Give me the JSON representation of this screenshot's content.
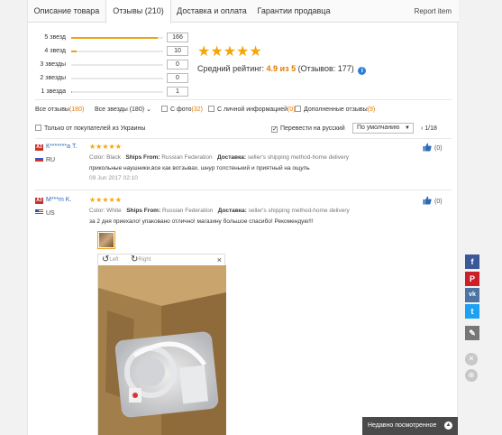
{
  "tabs": [
    {
      "label": "Описание товара"
    },
    {
      "label": "Отзывы (210)"
    },
    {
      "label": "Доставка и оплата"
    },
    {
      "label": "Гарантии продавца"
    }
  ],
  "report_label": "Report item",
  "rating_breakdown": [
    {
      "label": "5 звезд",
      "count": "166",
      "fraction": 0.94
    },
    {
      "label": "4 звезд",
      "count": "10",
      "fraction": 0.06
    },
    {
      "label": "3 звезды",
      "count": "0",
      "fraction": 0
    },
    {
      "label": "2 звезды",
      "count": "0",
      "fraction": 0
    },
    {
      "label": "1 звезда",
      "count": "1",
      "fraction": 0.01
    }
  ],
  "summary": {
    "stars": "★★★★★",
    "avg_label": "Средний рейтинг:",
    "avg_value": "4.9 из 5",
    "reviews_count": "(Отзывов: 177)",
    "info": "i"
  },
  "filters": {
    "all": {
      "label": "Все отзывы",
      "count": "(180)"
    },
    "all_stars": {
      "label": "Все звезды (180)"
    },
    "photo": {
      "label": "С фото",
      "count": "(32)"
    },
    "personal": {
      "label": "С личной информацией",
      "count": "(0)"
    },
    "extra": {
      "label": "Дополненные отзывы",
      "count": "(9)"
    }
  },
  "options": {
    "ukraine_only": "Только от покупателей из Украины",
    "translate": "Перевести на русский",
    "sort_value": "По умолчанию",
    "pager": "1/18"
  },
  "reviews": [
    {
      "badge": "A3",
      "name": "К*******а Т.",
      "country": "RU",
      "stars": "★★★★★",
      "meta_color_label": "Color:",
      "meta_color": "Black",
      "meta_ships_label": "Ships From:",
      "meta_ships": "Russian Federation",
      "meta_delivery_label": "Доставка:",
      "meta_delivery": "seller's shipping method-home delivery",
      "text": "прикольные наушники,все как вотзывах. шнур толстенький и приятный на ощупь",
      "date": "09 Jun 2017 02:10",
      "helpful": "(0)"
    },
    {
      "badge": "A3",
      "name": "М***m K.",
      "country": "US",
      "stars": "★★★★★",
      "meta_color_label": "Color:",
      "meta_color": "White",
      "meta_ships_label": "Ships From:",
      "meta_ships": "Russian Federation",
      "meta_delivery_label": "Доставка:",
      "meta_delivery": "seller's shipping method-home delivery",
      "text": "за 2 дня приехало! упаковано отлично! магазину большое спасибо! Рекомендую!!!",
      "helpful": "(0)"
    }
  ],
  "viewer": {
    "left_label": "Left",
    "right_label": "Right",
    "close": "×"
  },
  "social": [
    "f",
    "P",
    "vk",
    "t",
    "✎"
  ],
  "recently_viewed": "Недавно посмотренное",
  "colors": {
    "accent": "#f0a010",
    "link": "#2a6ab8",
    "count": "#e07a00"
  }
}
